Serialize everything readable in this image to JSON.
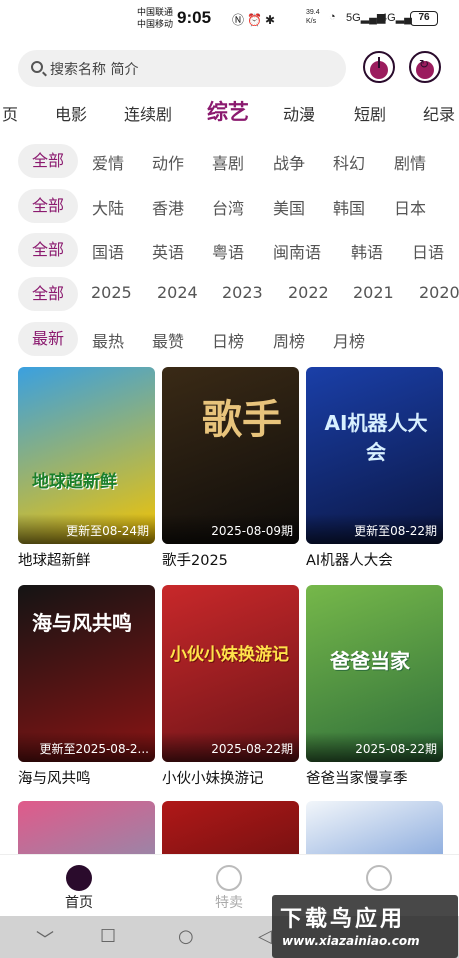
{
  "status_bar": {
    "carrier1": "中国联通",
    "carrier2": "中国移动",
    "time": "9:05",
    "net_speed_value": "39.4",
    "net_speed_unit": "K/s",
    "sig1": "5G",
    "sig2": "4G",
    "battery": "76"
  },
  "search": {
    "placeholder": "搜索名称 简介"
  },
  "channels": [
    "页",
    "电影",
    "连续剧",
    "综艺",
    "动漫",
    "短剧",
    "纪录"
  ],
  "active_channel": "综艺",
  "filters": {
    "genre": [
      "全部",
      "爱情",
      "动作",
      "喜剧",
      "战争",
      "科幻",
      "剧情"
    ],
    "region": [
      "全部",
      "大陆",
      "香港",
      "台湾",
      "美国",
      "韩国",
      "日本"
    ],
    "language": [
      "全部",
      "国语",
      "英语",
      "粤语",
      "闽南语",
      "韩语",
      "日语"
    ],
    "year": [
      "全部",
      "2025",
      "2024",
      "2023",
      "2022",
      "2021",
      "2020"
    ],
    "sort": [
      "最新",
      "最热",
      "最赞",
      "日榜",
      "周榜",
      "月榜"
    ]
  },
  "cards": [
    {
      "title": "地球超新鲜",
      "update": "更新至08-24期",
      "poster_text": "地球超新鲜",
      "colors": [
        "#3aa0e0",
        "#f5c400"
      ]
    },
    {
      "title": "歌手2025",
      "update": "2025-08-09期",
      "poster_text": "歌手",
      "colors": [
        "#3a2a16",
        "#0e0c0a"
      ]
    },
    {
      "title": "AI机器人大会",
      "update": "更新至08-22期",
      "poster_text": "AI机器人大会",
      "colors": [
        "#1a3fa8",
        "#0b1642"
      ]
    },
    {
      "title": "海与风共鸣",
      "update": "更新至2025-08-2...",
      "poster_text": "海与风共鸣",
      "colors": [
        "#141414",
        "#8b1414"
      ]
    },
    {
      "title": "小伙小妹换游记",
      "update": "2025-08-22期",
      "poster_text": "小伙小妹换游记",
      "colors": [
        "#c8282a",
        "#6c1418"
      ]
    },
    {
      "title": "爸爸当家慢享季",
      "update": "2025-08-22期",
      "poster_text": "爸爸当家",
      "colors": [
        "#76b84a",
        "#2e6e3a"
      ]
    },
    {
      "title": "",
      "update": "",
      "poster_text": "",
      "colors": [
        "#e05a8a",
        "#4bb6c8"
      ]
    },
    {
      "title": "",
      "update": "",
      "poster_text": "",
      "colors": [
        "#b01818",
        "#3a0a0a"
      ]
    },
    {
      "title": "",
      "update": "",
      "poster_text": "",
      "colors": [
        "#f2f6fa",
        "#1d5bbf"
      ]
    }
  ],
  "bottom_nav": [
    {
      "label": "首页",
      "icon": "home-icon",
      "active": true
    },
    {
      "label": "特卖",
      "icon": "sale-icon",
      "active": false
    },
    {
      "label": "",
      "icon": "profile-icon",
      "active": false
    }
  ],
  "accent_color": "#8b1a6f",
  "watermark": {
    "title": "下载鸟应用",
    "url": "www.xiazainiao.com"
  }
}
